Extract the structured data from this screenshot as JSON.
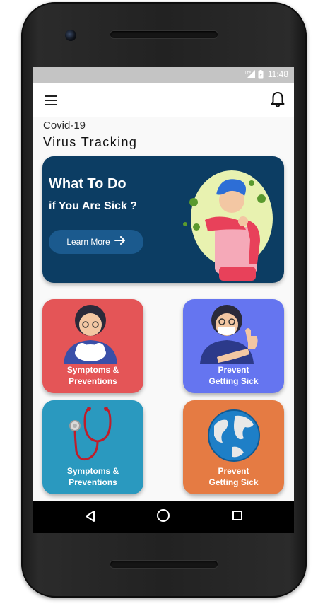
{
  "status_bar": {
    "network": "LTE",
    "time": "11:48"
  },
  "app_bar": {
    "menu_icon": "menu-icon",
    "notification_icon": "bell-icon"
  },
  "header": {
    "subtitle": "Covid-19",
    "title": "Virus Tracking"
  },
  "banner": {
    "heading": "What To Do",
    "subheading": "if You Are Sick ?",
    "button_label": "Learn More",
    "button_icon": "arrow-right-icon",
    "background": "#0c3d63"
  },
  "cards": [
    {
      "line1": "Symptoms &",
      "line2": "Preventions",
      "color": "#e45557",
      "icon": "woman-coughing-illustration"
    },
    {
      "line1": "Prevent",
      "line2": "Getting Sick",
      "color": "#6575f0",
      "icon": "woman-mask-thumbs-up-illustration"
    },
    {
      "line1": "Symptoms &",
      "line2": "Preventions",
      "color": "#2a99bf",
      "icon": "stethoscope-icon"
    },
    {
      "line1": "Prevent",
      "line2": "Getting Sick",
      "color": "#e57b43",
      "icon": "globe-icon"
    }
  ],
  "nav_bar": {
    "back_icon": "back-icon",
    "home_icon": "home-icon",
    "recents_icon": "recents-icon"
  }
}
